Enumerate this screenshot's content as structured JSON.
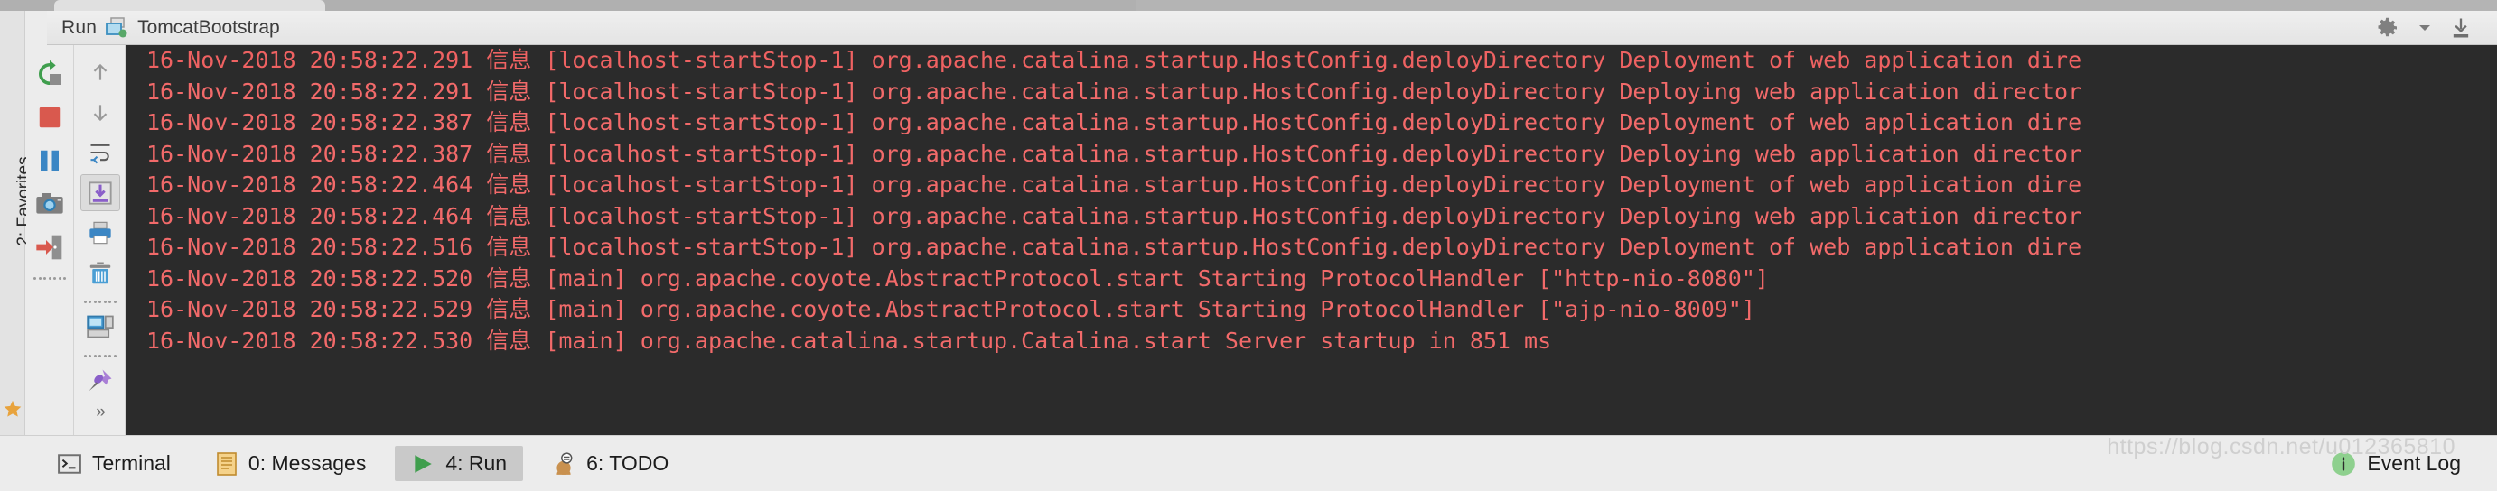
{
  "header": {
    "run_label": "Run",
    "config_name": "TomcatBootstrap",
    "config_icon": "tomcat-run-config-icon",
    "settings_icon": "gear-icon",
    "settings_dropdown_icon": "chevron-down-icon",
    "hide_icon": "hide-window-icon"
  },
  "left_stripe": {
    "favorites_label_prefix": "2",
    "favorites_label": "2: Favorites",
    "favorites_icon": "star-icon"
  },
  "toolbar_primary": {
    "items": [
      {
        "name": "rerun-button",
        "icon": "rerun-icon",
        "label": "Rerun"
      },
      {
        "name": "stop-button",
        "icon": "stop-square-icon",
        "label": "Stop"
      },
      {
        "name": "pause-button",
        "icon": "pause-icon",
        "label": "Pause Output"
      },
      {
        "name": "dump-threads-button",
        "icon": "camera-icon",
        "label": "Dump Threads"
      },
      {
        "name": "exit-button",
        "icon": "exit-arrow-icon",
        "label": "Exit"
      }
    ]
  },
  "toolbar_secondary": {
    "items": [
      {
        "name": "scroll-up-button",
        "icon": "arrow-up-icon",
        "label": "Up the Stack Trace"
      },
      {
        "name": "scroll-down-button",
        "icon": "arrow-down-icon",
        "label": "Down the Stack Trace"
      },
      {
        "name": "soft-wrap-button",
        "icon": "soft-wrap-icon",
        "label": "Use Soft Wraps"
      },
      {
        "name": "scroll-to-end-button",
        "icon": "scroll-to-end-icon",
        "label": "Scroll to the end",
        "pressed": true
      },
      {
        "name": "print-button",
        "icon": "printer-icon",
        "label": "Print"
      },
      {
        "name": "clear-all-button",
        "icon": "trash-icon",
        "label": "Clear All"
      },
      {
        "name": "preview-button",
        "icon": "console-preview-icon",
        "label": "Preview"
      },
      {
        "name": "pin-tab-button",
        "icon": "pin-icon",
        "label": "Pin Tab"
      }
    ],
    "expand_label": "»"
  },
  "console": {
    "lines": [
      "16-Nov-2018 20:58:22.291 信息 [localhost-startStop-1] org.apache.catalina.startup.HostConfig.deployDirectory Deployment of web application dire",
      "16-Nov-2018 20:58:22.291 信息 [localhost-startStop-1] org.apache.catalina.startup.HostConfig.deployDirectory Deploying web application director",
      "16-Nov-2018 20:58:22.387 信息 [localhost-startStop-1] org.apache.catalina.startup.HostConfig.deployDirectory Deployment of web application dire",
      "16-Nov-2018 20:58:22.387 信息 [localhost-startStop-1] org.apache.catalina.startup.HostConfig.deployDirectory Deploying web application director",
      "16-Nov-2018 20:58:22.464 信息 [localhost-startStop-1] org.apache.catalina.startup.HostConfig.deployDirectory Deployment of web application dire",
      "16-Nov-2018 20:58:22.464 信息 [localhost-startStop-1] org.apache.catalina.startup.HostConfig.deployDirectory Deploying web application director",
      "16-Nov-2018 20:58:22.516 信息 [localhost-startStop-1] org.apache.catalina.startup.HostConfig.deployDirectory Deployment of web application dire",
      "16-Nov-2018 20:58:22.520 信息 [main] org.apache.coyote.AbstractProtocol.start Starting ProtocolHandler [\"http-nio-8080\"]",
      "16-Nov-2018 20:58:22.529 信息 [main] org.apache.coyote.AbstractProtocol.start Starting ProtocolHandler [\"ajp-nio-8009\"]",
      "16-Nov-2018 20:58:22.530 信息 [main] org.apache.catalina.startup.Catalina.start Server startup in 851 ms"
    ],
    "text_color": "#f26a6a",
    "background_color": "#2b2b2b"
  },
  "bottom_bar": {
    "tabs": [
      {
        "name": "tab-terminal",
        "label": "Terminal",
        "icon": "terminal-icon",
        "active": false
      },
      {
        "name": "tab-messages",
        "label": "0: Messages",
        "icon": "messages-icon",
        "active": false
      },
      {
        "name": "tab-run",
        "label": "4: Run",
        "icon": "run-play-icon",
        "active": true
      },
      {
        "name": "tab-todo",
        "label": "6: TODO",
        "icon": "todo-icon",
        "active": false
      }
    ],
    "event_log_label": "Event Log",
    "event_log_icon": "info-badge-icon"
  },
  "watermark": "https://blog.csdn.net/u012365810"
}
